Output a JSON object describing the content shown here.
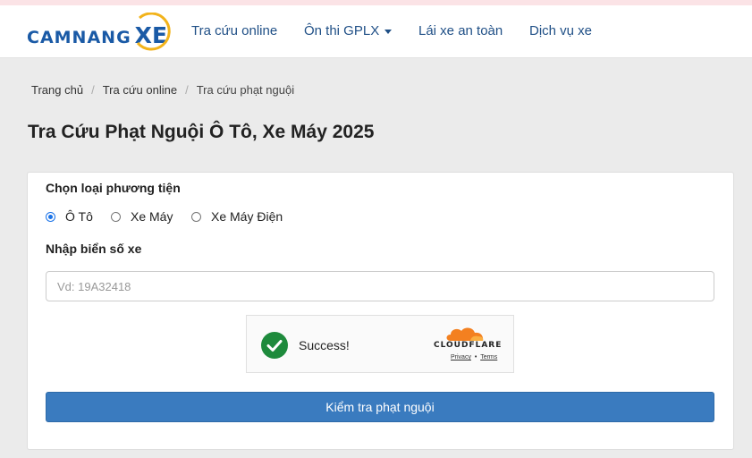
{
  "header": {
    "logo": {
      "brand": "CAMNANG",
      "brand_accent": "XE"
    },
    "nav": [
      {
        "label": "Tra cứu online"
      },
      {
        "label": "Ôn thi GPLX",
        "has_dropdown": true
      },
      {
        "label": "Lái xe an toàn"
      },
      {
        "label": "Dịch vụ xe"
      }
    ]
  },
  "breadcrumb": [
    "Trang chủ",
    "Tra cứu online",
    "Tra cứu phạt nguội"
  ],
  "page_title": "Tra Cứu Phạt Nguội Ô Tô, Xe Máy 2025",
  "form": {
    "vehicle_label": "Chọn loại phương tiện",
    "vehicle_options": [
      "Ô Tô",
      "Xe Máy",
      "Xe Máy Điện"
    ],
    "vehicle_selected": "Ô Tô",
    "plate_label": "Nhập biển số xe",
    "plate_value": "",
    "plate_placeholder": "Vd: 19A32418",
    "captcha": {
      "status_text": "Success!",
      "provider": "CLOUDFLARE",
      "privacy_link": "Privacy",
      "separator": "•",
      "terms_link": "Terms"
    },
    "submit_label": "Kiểm tra phạt nguội"
  },
  "colors": {
    "brand_blue": "#1a5aa6",
    "nav_text": "#1f4f86",
    "button_blue": "#3a7bbf",
    "success_green": "#1e8a3c",
    "cloudflare_orange": "#f38020",
    "page_bg": "#ebebeb"
  }
}
